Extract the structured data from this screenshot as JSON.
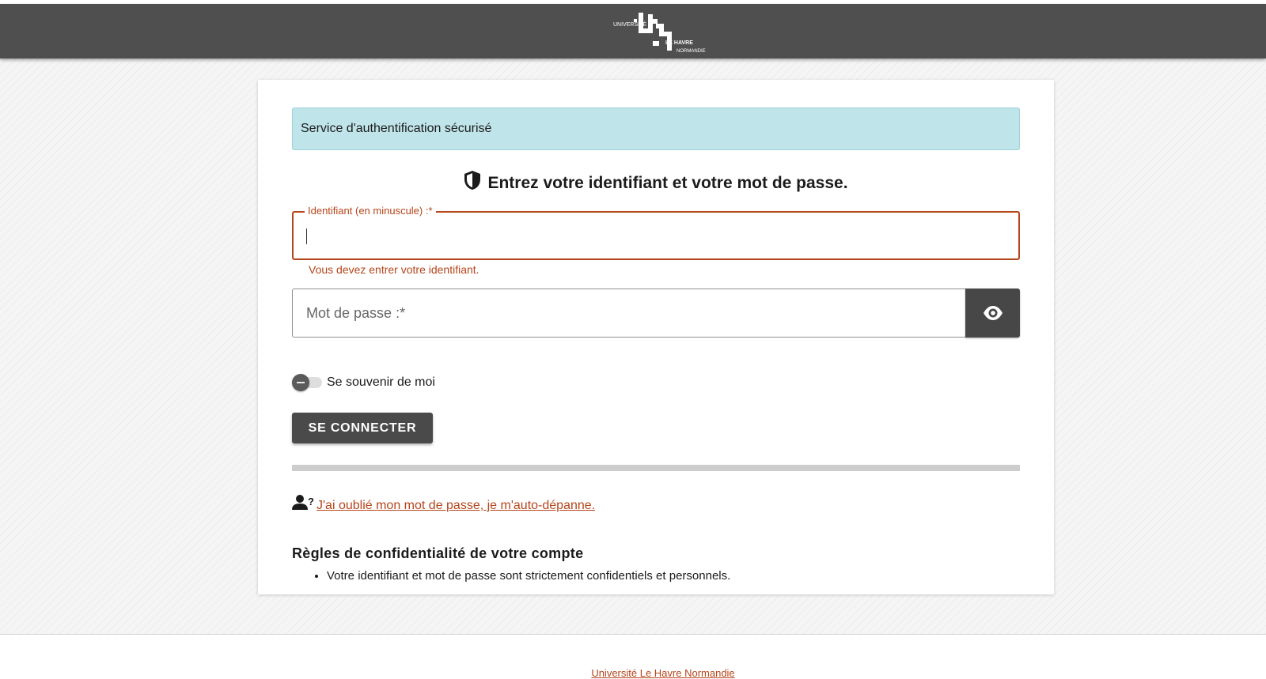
{
  "header": {
    "logo_text_top": "UNIVERSITÉ",
    "logo_text_mid": "LE HAVRE",
    "logo_text_bottom": "NORMANDIE"
  },
  "login": {
    "banner": "Service d'authentification sécurisé",
    "heading": "Entrez votre identifiant et votre mot de passe.",
    "username_label": "Identifiant (en minuscule) :*",
    "username_value": "",
    "username_error": "Vous devez entrer votre identifiant.",
    "password_placeholder": "Mot de passe :*",
    "remember_label": "Se souvenir de moi",
    "remember_checked": false,
    "submit_label": "SE CONNECTER",
    "forgot_link": "J'ai oublié mon mot de passe, je m'auto-dépanne."
  },
  "rules": {
    "title": "Règles de confidentialité de votre compte",
    "items": [
      "Votre identifiant et mot de passe sont strictement confidentiels et personnels."
    ]
  },
  "footer": {
    "link": "Université Le Havre Normandie"
  },
  "colors": {
    "header_bg": "#4f4f4f",
    "accent_error": "#b5451b",
    "banner_bg": "#bfe4e9",
    "button_bg": "#4a4a4a"
  },
  "icons": {
    "heading": "shield-icon",
    "password_toggle": "eye-icon",
    "forgot": "user-question-icon"
  }
}
